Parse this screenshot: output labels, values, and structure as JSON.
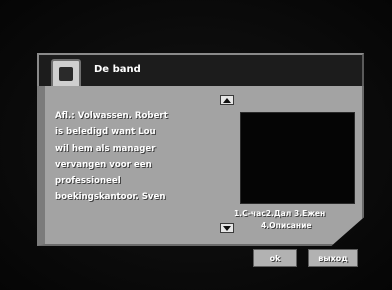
{
  "dialog": {
    "title": "De band",
    "description_lines": [
      "Afl.: Volwassen. Robert",
      "is beledigd want Lou",
      "wil hem als manager",
      "vervangen voor een",
      "professioneel",
      "boekingskantoor. Sven"
    ],
    "options_line1": "1.С-час2.Дал 3.Ежен",
    "options_line2": "4.Описание"
  },
  "buttons": {
    "ok_label": "ok",
    "exit_label": "выход"
  }
}
